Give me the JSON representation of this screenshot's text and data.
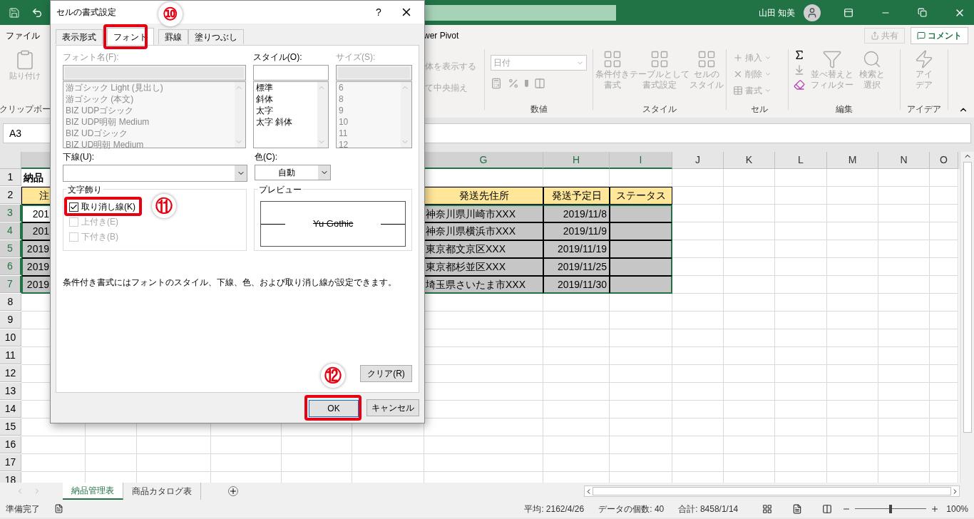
{
  "title_bar": {
    "user": "山田 知美"
  },
  "ribbon": {
    "tabs": [
      {
        "label": "ファイル"
      },
      {
        "label": "wer Pivot"
      }
    ],
    "share": "共有",
    "comment": "コメント",
    "clipboard": {
      "label": "クリップボー",
      "paste": "貼り付け"
    },
    "alignment": {
      "items": [
        "体を表示する",
        "て中央揃え"
      ]
    },
    "number": {
      "label": "数値",
      "format": "日付"
    },
    "styles": {
      "label": "スタイル",
      "items": [
        [
          "条件付き",
          "書式"
        ],
        [
          "テーブルとして",
          "書式設定"
        ],
        [
          "セルの",
          "スタイル"
        ]
      ]
    },
    "cells": {
      "label": "セル",
      "items": [
        {
          "kind": "insert",
          "label": "挿入"
        },
        {
          "kind": "delete",
          "label": "削除"
        },
        {
          "kind": "format",
          "label": "書式"
        }
      ]
    },
    "editing": {
      "label": "編集",
      "items": [
        [
          "並べ替えと",
          "フィルター"
        ],
        [
          "検索と",
          "選択"
        ]
      ]
    },
    "ideas": {
      "label": "アイデア",
      "items": [
        "アイ",
        "デア"
      ]
    }
  },
  "name_box": "A3",
  "columns": [
    {
      "label": "G",
      "selected": true
    },
    {
      "label": "H",
      "selected": true
    },
    {
      "label": "I",
      "selected": true
    },
    {
      "label": "J",
      "selected": false
    },
    {
      "label": "K",
      "selected": false
    },
    {
      "label": "L",
      "selected": false
    },
    {
      "label": "M",
      "selected": false
    },
    {
      "label": "N",
      "selected": false
    },
    {
      "label": "O",
      "selected": false
    }
  ],
  "rows": [
    {
      "number": "1",
      "kind": "title",
      "selected": false,
      "col_a": "納品"
    },
    {
      "number": "2",
      "kind": "header",
      "selected": false,
      "col_a": "注",
      "col_g": "発送先住所",
      "col_h": "発送予定日",
      "col_i": "ステータス"
    },
    {
      "number": "3",
      "kind": "data",
      "selected": true,
      "active": true,
      "col_a": "201",
      "col_g": "神奈川県川崎市XXX",
      "col_h": "2019/11/8"
    },
    {
      "number": "4",
      "kind": "data",
      "selected": true,
      "active": false,
      "col_a": "201",
      "col_g": "神奈川県横浜市XXX",
      "col_h": "2019/11/9"
    },
    {
      "number": "5",
      "kind": "data",
      "selected": true,
      "active": false,
      "col_a": "2019",
      "col_g": "東京都文京区XXX",
      "col_h": "2019/11/19"
    },
    {
      "number": "6",
      "kind": "data",
      "selected": true,
      "active": false,
      "col_a": "2019",
      "col_g": "東京都杉並区XXX",
      "col_h": "2019/11/25"
    },
    {
      "number": "7",
      "kind": "data",
      "selected": true,
      "active": false,
      "col_a": "2019",
      "col_g": "埼玉県さいたま市XXX",
      "col_h": "2019/11/30"
    },
    {
      "number": "8",
      "kind": "empty",
      "selected": false
    },
    {
      "number": "9",
      "kind": "empty",
      "selected": false
    },
    {
      "number": "10",
      "kind": "empty",
      "selected": false
    },
    {
      "number": "11",
      "kind": "empty",
      "selected": false
    },
    {
      "number": "12",
      "kind": "empty",
      "selected": false
    },
    {
      "number": "13",
      "kind": "empty",
      "selected": false
    },
    {
      "number": "14",
      "kind": "empty",
      "selected": false
    },
    {
      "number": "15",
      "kind": "empty",
      "selected": false
    },
    {
      "number": "16",
      "kind": "empty",
      "selected": false
    },
    {
      "number": "17",
      "kind": "empty",
      "selected": false
    },
    {
      "number": "18",
      "kind": "empty",
      "selected": false
    }
  ],
  "sheet_tabs": [
    {
      "label": "納品管理表",
      "selected": true
    },
    {
      "label": "商品カタログ表",
      "selected": false
    }
  ],
  "status_bar": {
    "ready": "準備完了",
    "stats": [
      "平均: 2162/4/26",
      "データの個数: 40",
      "合計: 8458/1/14"
    ],
    "zoom": "100%",
    "zoom_slider": {
      "level": 0.5
    }
  },
  "dialog": {
    "title": "セルの書式設定",
    "help": "?",
    "tabs": [
      {
        "label": "表示形式",
        "selected": false
      },
      {
        "label": "フォント",
        "selected": true,
        "callout": "⑩"
      },
      {
        "label": "罫線",
        "selected": false
      },
      {
        "label": "塗りつぶし",
        "selected": false
      }
    ],
    "font_name": {
      "label": "フォント名(F):",
      "disabled": true,
      "items": [
        "游ゴシック Light (見出し)",
        "游ゴシック (本文)",
        "BIZ UDPゴシック",
        "BIZ UDP明朝 Medium",
        "BIZ UDゴシック",
        "BIZ UD明朝 Medium"
      ]
    },
    "style": {
      "label": "スタイル(O):",
      "disabled": false,
      "items": [
        "標準",
        "斜体",
        "太字",
        "太字 斜体"
      ]
    },
    "size": {
      "label": "サイズ(S):",
      "disabled": true,
      "items": [
        "6",
        "8",
        "9",
        "10",
        "11",
        "12"
      ]
    },
    "underline": {
      "label": "下線(U):"
    },
    "color": {
      "label": "色(C):",
      "value": "自動"
    },
    "effects": {
      "label": "文字飾り",
      "items": [
        {
          "kind": "strikethrough",
          "label": "取り消し線(K)",
          "checked": true,
          "disabled": false,
          "callout": "⑪"
        },
        {
          "kind": "superscript",
          "label": "上付き(E)",
          "checked": false,
          "disabled": true
        },
        {
          "kind": "subscript",
          "label": "下付き(B)",
          "checked": false,
          "disabled": true
        }
      ]
    },
    "preview": {
      "label": "プレビュー",
      "sample": "Yu Gothic"
    },
    "note": "条件付き書式にはフォントのスタイル、下線、色、および取り消し線が設定できます。",
    "clear": "クリア(R)",
    "ok": {
      "label": "OK",
      "callout": "⑫"
    },
    "cancel": "キャンセル"
  }
}
